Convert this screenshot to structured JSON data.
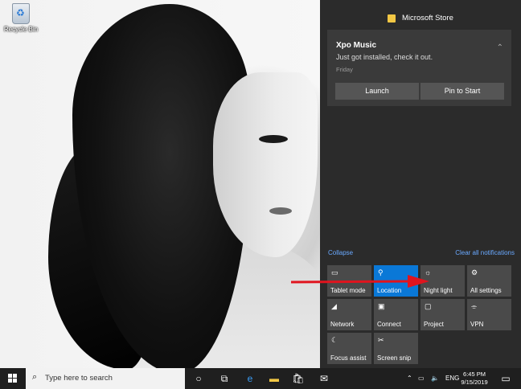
{
  "desktop": {
    "recycle_bin_label": "Recycle Bin"
  },
  "action_center": {
    "header_title": "Microsoft Store",
    "notification": {
      "title": "Xpo Music",
      "text": "Just got installed, check it out.",
      "time": "Friday",
      "buttons": [
        "Launch",
        "Pin to Start"
      ]
    },
    "collapse_label": "Collapse",
    "clear_label": "Clear all notifications",
    "tiles": [
      {
        "label": "Tablet mode",
        "icon": "tablet-mode-icon",
        "active": false
      },
      {
        "label": "Location",
        "icon": "location-icon",
        "active": true
      },
      {
        "label": "Night light",
        "icon": "night-light-icon",
        "active": false
      },
      {
        "label": "All settings",
        "icon": "gear-icon",
        "active": false
      },
      {
        "label": "Network",
        "icon": "network-icon",
        "active": false
      },
      {
        "label": "Connect",
        "icon": "connect-icon",
        "active": false
      },
      {
        "label": "Project",
        "icon": "project-icon",
        "active": false
      },
      {
        "label": "VPN",
        "icon": "vpn-icon",
        "active": false
      },
      {
        "label": "Focus assist",
        "icon": "moon-icon",
        "active": false
      },
      {
        "label": "Screen snip",
        "icon": "screen-snip-icon",
        "active": false
      }
    ]
  },
  "taskbar": {
    "search_placeholder": "Type here to search",
    "language": "ENG",
    "time": "6:45 PM",
    "date": "9/15/2019"
  },
  "colors": {
    "action_center_bg": "#2b2b2b",
    "active_tile": "#0a78d7",
    "tile_bg": "#4a4a4a",
    "link": "#6aa9ff",
    "arrow": "#e0141e"
  }
}
